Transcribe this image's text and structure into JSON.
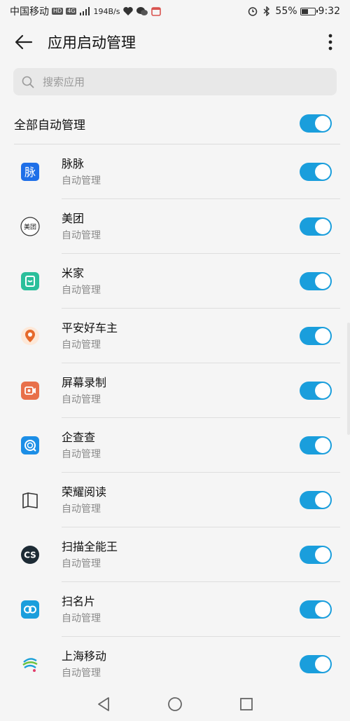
{
  "status_bar": {
    "carrier": "中国移动",
    "hd_badge": "HD",
    "net_badge": "4G",
    "speed": "194B/s",
    "battery": "55%",
    "battery_level": 0.55,
    "time": "9:32"
  },
  "header": {
    "title": "应用启动管理"
  },
  "search": {
    "placeholder": "搜索应用"
  },
  "all_toggle": {
    "label": "全部自动管理",
    "on": true
  },
  "apps": [
    {
      "name": "脉脉",
      "status": "自动管理",
      "icon": "maimai-icon",
      "icon_glyph": "脉",
      "color": "#1e6fe8",
      "on": true
    },
    {
      "name": "美团",
      "status": "自动管理",
      "icon": "meituan-icon",
      "icon_glyph": "美团",
      "color": "#333333",
      "on": true
    },
    {
      "name": "米家",
      "status": "自动管理",
      "icon": "mijia-icon",
      "icon_glyph": "",
      "color": "#2bbf9b",
      "on": true
    },
    {
      "name": "平安好车主",
      "status": "自动管理",
      "icon": "pingan-icon",
      "icon_glyph": "",
      "color": "#e66a2c",
      "on": true
    },
    {
      "name": "屏幕录制",
      "status": "自动管理",
      "icon": "screen-record-icon",
      "icon_glyph": "",
      "color": "#e8704a",
      "on": true
    },
    {
      "name": "企查查",
      "status": "自动管理",
      "icon": "qichacha-icon",
      "icon_glyph": "",
      "color": "#1c8ee6",
      "on": true
    },
    {
      "name": "荣耀阅读",
      "status": "自动管理",
      "icon": "honor-reader-icon",
      "icon_glyph": "",
      "color": "#333333",
      "on": true
    },
    {
      "name": "扫描全能王",
      "status": "自动管理",
      "icon": "camscanner-icon",
      "icon_glyph": "CS",
      "color": "#1d2b35",
      "on": true
    },
    {
      "name": "扫名片",
      "status": "自动管理",
      "icon": "card-scan-icon",
      "icon_glyph": "",
      "color": "#1a9edc",
      "on": true
    },
    {
      "name": "上海移动",
      "status": "自动管理",
      "icon": "china-mobile-icon",
      "icon_glyph": "",
      "color": "#1aa0d8",
      "on": true
    }
  ],
  "colors": {
    "accent": "#1a9edc",
    "background": "#f5f5f5"
  }
}
